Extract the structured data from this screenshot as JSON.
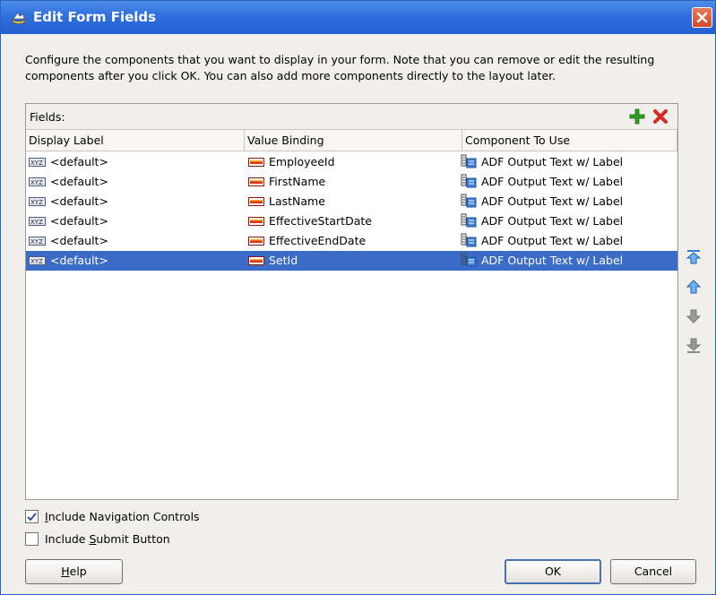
{
  "dialog": {
    "title": "Edit Form Fields",
    "description_line1": "Configure the components that you want to display in your form.  Note that you can remove or edit the resulting",
    "description_line2": "components after you click OK.  You can also add more components directly to the layout later."
  },
  "fields_panel": {
    "label": "Fields:",
    "columns": [
      "Display Label",
      "Value Binding",
      "Component To Use"
    ],
    "rows": [
      {
        "display_label": "<default>",
        "value_binding": "EmployeeId",
        "component": "ADF Output Text w/ Label",
        "selected": false
      },
      {
        "display_label": "<default>",
        "value_binding": "FirstName",
        "component": "ADF Output Text w/ Label",
        "selected": false
      },
      {
        "display_label": "<default>",
        "value_binding": "LastName",
        "component": "ADF Output Text w/ Label",
        "selected": false
      },
      {
        "display_label": "<default>",
        "value_binding": "EffectiveStartDate",
        "component": "ADF Output Text w/ Label",
        "selected": false
      },
      {
        "display_label": "<default>",
        "value_binding": "EffectiveEndDate",
        "component": "ADF Output Text w/ Label",
        "selected": false
      },
      {
        "display_label": "<default>",
        "value_binding": "SetId",
        "component": "ADF Output Text w/ Label",
        "selected": true
      }
    ],
    "toolbar_icons": [
      "add-icon",
      "delete-icon"
    ],
    "side_icons": [
      "move-to-top-icon",
      "move-up-icon",
      "move-down-icon",
      "move-to-bottom-icon"
    ]
  },
  "options": {
    "nav_controls": {
      "prefix": "",
      "mnemonic": "I",
      "rest": "nclude Navigation Controls",
      "checked": true
    },
    "submit_button": {
      "prefix": "Include ",
      "mnemonic": "S",
      "rest": "ubmit Button",
      "checked": false
    }
  },
  "buttons": {
    "help": {
      "mnemonic": "H",
      "rest": "elp"
    },
    "ok": "OK",
    "cancel": "Cancel"
  },
  "colors": {
    "titlebar": "#245fd0",
    "selection": "#3a6bc6",
    "add_green": "#2e9e1f",
    "delete_red": "#d8281c"
  }
}
